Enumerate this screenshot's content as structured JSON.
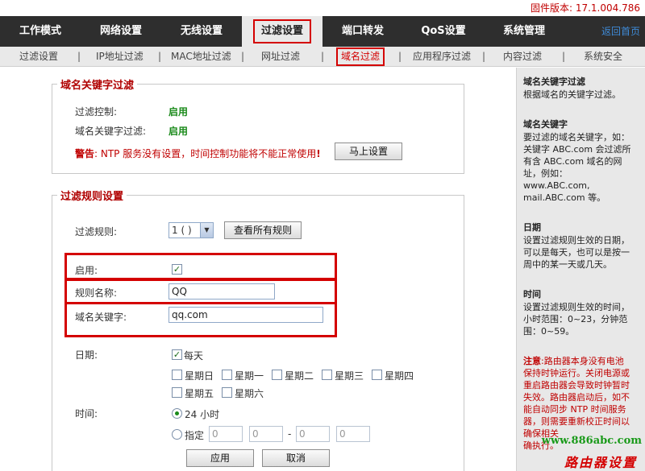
{
  "firmware": "固件版本: 17.1.004.786",
  "topnav": {
    "items": [
      "工作模式",
      "网络设置",
      "无线设置",
      "过滤设置",
      "端口转发",
      "QoS设置",
      "系统管理"
    ],
    "home": "返回首页"
  },
  "subnav": {
    "items": [
      "过滤设置",
      "IP地址过滤",
      "MAC地址过滤",
      "网址过滤",
      "域名过滤",
      "应用程序过滤",
      "内容过滤",
      "系统安全"
    ],
    "sep": "|"
  },
  "panel1": {
    "title": "域名关键字过滤",
    "filter_control_label": "过滤控制:",
    "filter_control_value": "启用",
    "domain_filter_label": "域名关键字过滤:",
    "domain_filter_value": "启用",
    "warning_prefix": "警告",
    "warning_text": ": NTP 服务没有设置，时间控制功能将不能正常使用",
    "warning_mark": "!",
    "setup_button": "马上设置"
  },
  "panel2": {
    "title": "过滤规则设置",
    "rule_label": "过滤规则:",
    "rule_select": "1 ( )",
    "view_all_button": "查看所有规则",
    "enable_label": "启用:",
    "enable_checked": true,
    "rule_name_label": "规则名称:",
    "rule_name_value": "QQ",
    "keyword_label": "域名关键字:",
    "keyword_value": "qq.com",
    "date_label": "日期:",
    "everyday_label": "每天",
    "days": [
      "星期日",
      "星期一",
      "星期二",
      "星期三",
      "星期四",
      "星期五",
      "星期六"
    ],
    "time_label": "时间:",
    "time_24h": "24 小时",
    "time_custom": "指定",
    "time_fields": [
      "0",
      "0",
      "0",
      "0"
    ],
    "time_dash": "-",
    "apply_button": "应用",
    "cancel_button": "取消"
  },
  "sidebar": {
    "h1": "域名关键字过滤",
    "b1": "根据域名的关键字过滤。",
    "h2": "域名关键字",
    "b2a": "要过滤的域名关键字，如：",
    "b2b": "关键字  ABC.com 会过滤所",
    "b2c": "有含  ABC.com 域名的网",
    "b2d": "址，例如：",
    "b2e": "www.ABC.com,",
    "b2f": "mail.ABC.com 等。",
    "h3": "日期",
    "b3a": "设置过滤规则生效的日期，",
    "b3b": "可以是每天，也可以是按一",
    "b3c": "周中的某一天或几天。",
    "h4": "时间",
    "b4a": "设置过滤规则生效的时间，",
    "b4b": "小时范围：0~23，分钟范",
    "b4c": "围：0~59。",
    "note_prefix": "注意",
    "note_lines": [
      ":路由器本身没有电池",
      "保持时钟运行。关闭电源或",
      "重启路由器会导致时钟暂时",
      "失效。路由器启动后，如不",
      "能自动同步  NTP 时间服务",
      "器，则需要重新校正时间以",
      "确保相关",
      "确执行。"
    ]
  },
  "watermark": {
    "url": "www.886abc.com",
    "text": "路由器设置"
  }
}
